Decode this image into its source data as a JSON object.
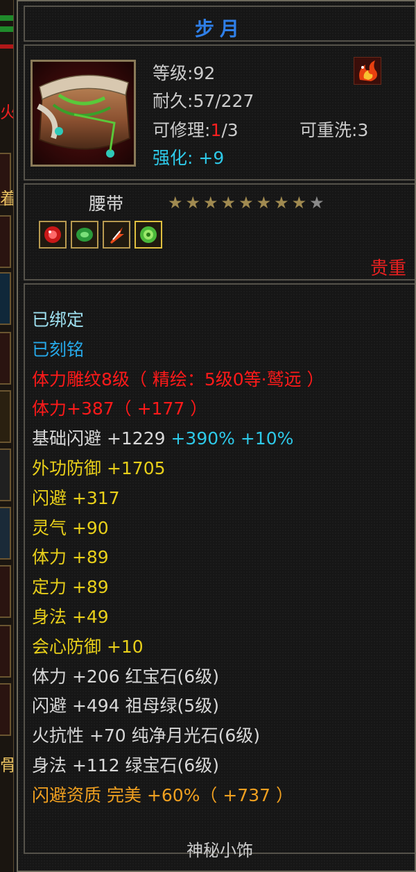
{
  "item": {
    "name": "步月",
    "level_label": "等级:",
    "level": "92",
    "durability_label": "耐久:",
    "durability": "57/227",
    "repair_label": "可修理:",
    "repair_current": "1",
    "repair_max": "/3",
    "reroll_label": "可重洗:",
    "reroll": "3",
    "enhance_label": "强化:",
    "enhance": "+9",
    "type": "腰带",
    "stars_total": 9,
    "stars_filled": 8,
    "rarity": "贵重"
  },
  "left_strip": {
    "glyph_top": "火",
    "glyph_mid": "着",
    "glyph_bottom": "骨"
  },
  "attributes": [
    {
      "segments": [
        {
          "text": "已绑定",
          "color": "lightblue"
        }
      ]
    },
    {
      "segments": [
        {
          "text": "已刻铭",
          "color": "blue"
        }
      ]
    },
    {
      "segments": [
        {
          "text": "体力雕纹8级（ 精绘：5级0等·鹫远 ）",
          "color": "red"
        }
      ]
    },
    {
      "segments": [
        {
          "text": "体力+387（ +177 ）",
          "color": "red"
        }
      ]
    },
    {
      "segments": [
        {
          "text": "基础闪避 +1229",
          "color": "white"
        },
        {
          "text": " +390% +10%",
          "color": "cyan"
        }
      ]
    },
    {
      "segments": [
        {
          "text": "外功防御 +1705",
          "color": "yellow"
        }
      ]
    },
    {
      "segments": [
        {
          "text": "闪避 +317",
          "color": "yellow"
        }
      ]
    },
    {
      "segments": [
        {
          "text": "灵气 +90",
          "color": "yellow"
        }
      ]
    },
    {
      "segments": [
        {
          "text": "体力 +89",
          "color": "yellow"
        }
      ]
    },
    {
      "segments": [
        {
          "text": "定力 +89",
          "color": "yellow"
        }
      ]
    },
    {
      "segments": [
        {
          "text": "身法 +49",
          "color": "yellow"
        }
      ]
    },
    {
      "segments": [
        {
          "text": "会心防御 +10",
          "color": "yellow"
        }
      ]
    },
    {
      "segments": [
        {
          "text": "体力 +206 红宝石(6级)",
          "color": "white"
        }
      ]
    },
    {
      "segments": [
        {
          "text": "闪避 +494 祖母绿(5级)",
          "color": "white"
        }
      ]
    },
    {
      "segments": [
        {
          "text": "火抗性 +70 纯净月光石(6级)",
          "color": "white"
        }
      ]
    },
    {
      "segments": [
        {
          "text": "身法 +112 绿宝石(6级)",
          "color": "white"
        }
      ]
    },
    {
      "segments": [
        {
          "text": "闪避资质 完美 +60%（ +737 ）",
          "color": "orange"
        }
      ]
    }
  ],
  "footer": "神秘小饰",
  "colors": {
    "title": "#2f7fe8",
    "rarity": "#e82020",
    "star_filled": "#a08a50",
    "star_empty": "#8a8a8a"
  },
  "icons": {
    "item": "belt-icon",
    "corner": "flame-icon",
    "gems": [
      "ruby-gem-icon",
      "emerald-gem-icon",
      "fire-gem-icon",
      "green-gem-icon"
    ]
  }
}
